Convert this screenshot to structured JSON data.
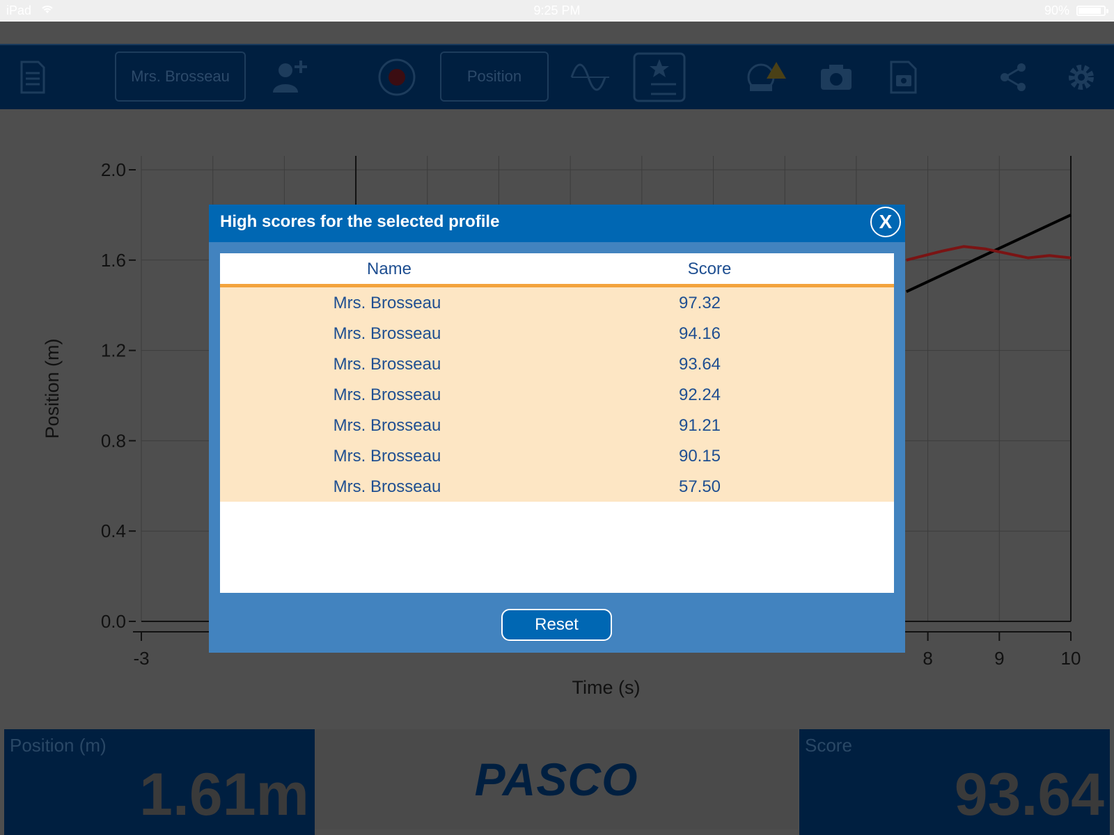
{
  "statusbar": {
    "device": "iPad",
    "time": "9:25 PM",
    "battery": "90%",
    "battery_level": 0.9
  },
  "toolbar": {
    "profile_label": "Mrs. Brosseau",
    "measurement_label": "Position"
  },
  "chart_data": {
    "type": "line",
    "xlabel": "Time (s)",
    "ylabel": "Position (m)",
    "xlim": [
      -3,
      10
    ],
    "ylim": [
      0.0,
      2.0
    ],
    "x_ticks": [
      "-3",
      "8",
      "9",
      "10"
    ],
    "y_ticks": [
      "0.0",
      "0.4",
      "0.8",
      "1.2",
      "1.6",
      "2.0"
    ],
    "grid": true,
    "series": [
      {
        "color": "#000000",
        "x": [
          7.7,
          10
        ],
        "y": [
          1.46,
          1.8
        ]
      },
      {
        "color": "#7a1414",
        "x": [
          7.7,
          8.2,
          8.5,
          8.8,
          9.1,
          9.4,
          9.7,
          10
        ],
        "y": [
          1.6,
          1.64,
          1.66,
          1.65,
          1.63,
          1.61,
          1.62,
          1.61
        ]
      }
    ]
  },
  "bottom": {
    "position_label": "Position (m)",
    "position_value": "1.61m",
    "logo": "PASCO",
    "score_label": "Score",
    "score_value": "93.64"
  },
  "dialog": {
    "title": "High scores for the selected profile",
    "close_label": "X",
    "columns": {
      "name": "Name",
      "score": "Score"
    },
    "rows": [
      {
        "name": "Mrs. Brosseau",
        "score": "97.32"
      },
      {
        "name": "Mrs. Brosseau",
        "score": "94.16"
      },
      {
        "name": "Mrs. Brosseau",
        "score": "93.64"
      },
      {
        "name": "Mrs. Brosseau",
        "score": "92.24"
      },
      {
        "name": "Mrs. Brosseau",
        "score": "91.21"
      },
      {
        "name": "Mrs. Brosseau",
        "score": "90.15"
      },
      {
        "name": "Mrs. Brosseau",
        "score": "57.50"
      }
    ],
    "reset_label": "Reset"
  }
}
